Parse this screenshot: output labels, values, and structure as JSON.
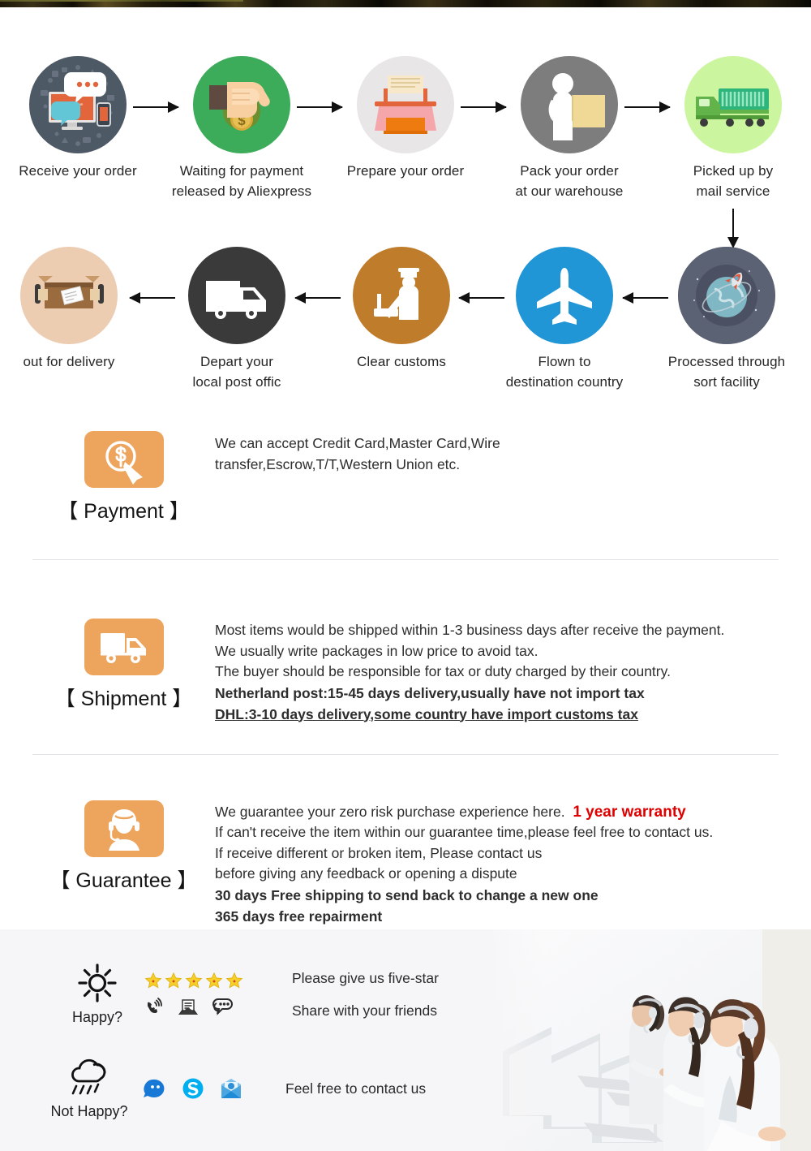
{
  "flow": {
    "row1": [
      {
        "caption": "Receive your order",
        "icon": "desktop-chat-icon",
        "circle_color": "#4e5966"
      },
      {
        "caption": "Waiting for payment\nreleased by Aliexpress",
        "icon": "hand-money-bag-icon",
        "circle_color": "#3cab5a"
      },
      {
        "caption": "Prepare your order",
        "icon": "printer-icon",
        "circle_color": "#e8e6e7"
      },
      {
        "caption": "Pack your order\nat our warehouse",
        "icon": "worker-package-icon",
        "circle_color": "#7d7d7d"
      },
      {
        "caption": "Picked up by\nmail service",
        "icon": "truck-container-icon",
        "circle_color": "#ccf5a0"
      }
    ],
    "row2": [
      {
        "caption": "out for delivery",
        "icon": "open-parcel-icon",
        "circle_color": "#edcdb2"
      },
      {
        "caption": "Depart your\nlocal post offic",
        "icon": "delivery-van-icon",
        "circle_color": "#3a3a3a"
      },
      {
        "caption": "Clear customs",
        "icon": "customs-officer-icon",
        "circle_color": "#bf7d2c"
      },
      {
        "caption": "Flown to\ndestination country",
        "icon": "airplane-icon",
        "circle_color": "#2196d6"
      },
      {
        "caption": "Processed through\nsort facility",
        "icon": "globe-rocket-icon",
        "circle_color": "#5b6273"
      }
    ],
    "arrow_icon": "arrow-right-icon",
    "arrow_down_icon": "arrow-down-icon"
  },
  "payment": {
    "badge_icon": "money-click-icon",
    "label": "【 Payment 】",
    "lines": [
      "We can accept Credit Card,Master Card,Wire",
      "transfer,Escrow,T/T,Western Union etc."
    ]
  },
  "shipment": {
    "badge_icon": "truck-icon",
    "label": "【 Shipment 】",
    "lines": [
      "Most items would be shipped within 1-3 business days after receive the payment.",
      "We usually write packages in low price to avoid tax.",
      "The buyer should be responsible for tax or duty charged by their country."
    ],
    "bold_line": "Netherland post:15-45 days delivery,usually have not import tax",
    "underlined_line": "DHL:3-10 days delivery,some country have import customs tax"
  },
  "guarantee": {
    "badge_icon": "support-agent-icon",
    "label": "【 Guarantee 】",
    "line1_normal": "We guarantee your zero risk purchase experience here.",
    "line1_red": "1 year warranty",
    "lines": [
      "If can't receive the item within our guarantee time,please feel free to contact us.",
      "If receive different or broken item, Please contact us",
      "before giving any feedback or opening a dispute"
    ],
    "red_lines": [
      "30 days Free shipping to send back to change a new one",
      "365 days free repairment"
    ]
  },
  "service": {
    "happy": {
      "label": "Happy?",
      "mood_icon": "sun-icon",
      "rating_icon": "star-icon",
      "star_count": 5,
      "contact_icons": [
        "phone-ring-icon",
        "envelope-icon",
        "chat-bubble-icon"
      ],
      "texts": [
        "Please give us five-star",
        "Share with your friends"
      ]
    },
    "not_happy": {
      "label": "Not Happy?",
      "mood_icon": "rain-cloud-icon",
      "contact_icons": [
        "trademanager-icon",
        "skype-icon",
        "email-icon"
      ],
      "texts": [
        "Feel free to contact us"
      ]
    },
    "photo_alt": "call-center-agents-photo"
  },
  "colors": {
    "accent_orange": "#eda45d",
    "alert_red": "#e00000",
    "divider": "#e2e0e4",
    "band_bg": "#f6f5f7"
  }
}
